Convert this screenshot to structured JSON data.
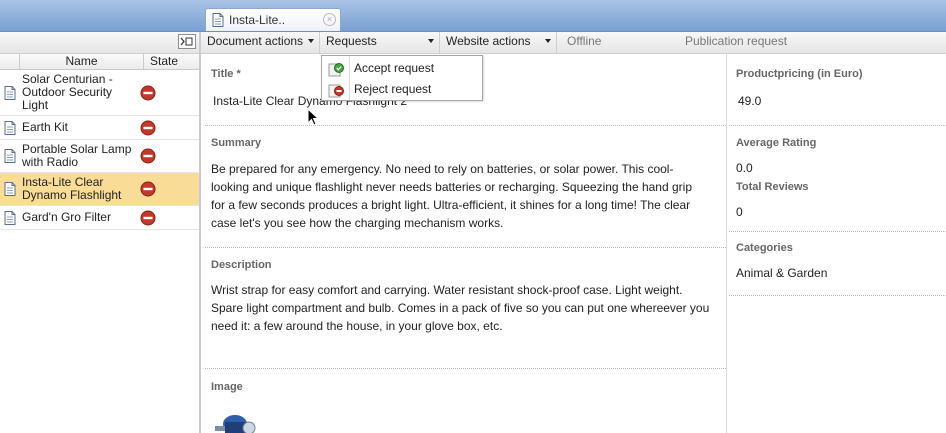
{
  "tab": {
    "title": "Insta-Lite..",
    "close_icon": "close-icon"
  },
  "left_panel": {
    "columns": {
      "name": "Name",
      "state": "State"
    },
    "items": [
      {
        "name": "Solar Centurian - Outdoor Security Light",
        "state_icon": "no-entry-icon"
      },
      {
        "name": "Earth Kit",
        "state_icon": "no-entry-icon"
      },
      {
        "name": "Portable Solar Lamp with Radio",
        "state_icon": "no-entry-icon"
      },
      {
        "name": "Insta-Lite Clear Dynamo Flashlight",
        "state_icon": "no-entry-icon",
        "selected": true
      },
      {
        "name": "Gard'n Gro Filter",
        "state_icon": "no-entry-icon"
      }
    ]
  },
  "toolbar": {
    "document_actions": "Document actions",
    "requests": "Requests",
    "website_actions": "Website actions",
    "offline": "Offline",
    "publication_request": "Publication request"
  },
  "requests_menu": {
    "items": [
      {
        "label": "Accept request"
      },
      {
        "label": "Reject request"
      }
    ]
  },
  "form": {
    "title_label": "Title *",
    "title_value": "Insta-Lite Clear Dynamo Flashlight 2",
    "summary_label": "Summary",
    "summary_lines": [
      "Be prepared for any emergency. No need to rely on batteries, or solar power. This cool-",
      "looking and unique flashlight never needs batteries or recharging. Squeezing the hand grip",
      "for a few seconds produces a bright light. Ultra-efficient, it shines for a long time! The clear",
      "case let's you see how the charging mechanism works."
    ],
    "description_label": "Description",
    "description_lines": [
      "Wrist strap for easy comfort and carrying. Water resistant shock-proof case. Light weight.",
      "Spare light compartment and bulb. Comes in a pack of five so you can put one whereever you",
      "need it: a few around the house, in your glove box, etc."
    ],
    "image_label": "Image"
  },
  "side_fields": {
    "pricing_label": "Productpricing (in Euro)",
    "pricing_value": "49.0",
    "rating_label": "Average Rating",
    "rating_value": "0.0",
    "reviews_label": "Total Reviews",
    "reviews_value": "0",
    "categories_label": "Categories",
    "categories_value": "Animal & Garden"
  },
  "colors": {
    "selection": "#f9dc95",
    "header_blue": "#7aa0d2",
    "state_red": "#c0392b"
  }
}
